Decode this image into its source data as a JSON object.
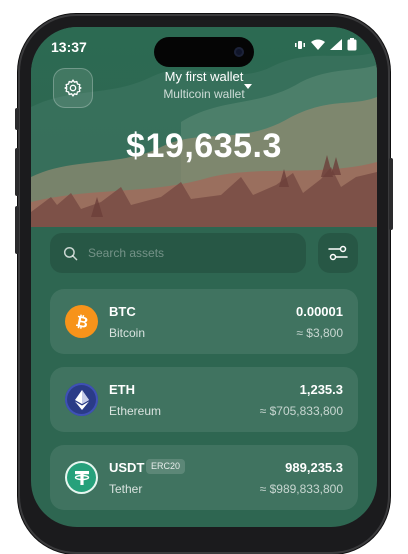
{
  "status_bar": {
    "time": "13:37"
  },
  "header": {
    "wallet_name": "My first wallet",
    "wallet_type": "Multicoin wallet",
    "balance": "$19,635.3"
  },
  "search": {
    "placeholder": "Search assets"
  },
  "colors": {
    "screen_bg": "#2e6651",
    "btc": "#f7931a",
    "eth": "#5a6ac6",
    "usdt": "#26a17b"
  },
  "assets": [
    {
      "symbol": "BTC",
      "name": "Bitcoin",
      "amount": "0.00001",
      "fiat": "≈ $3,800",
      "icon": "bitcoin-icon"
    },
    {
      "symbol": "ETH",
      "name": "Ethereum",
      "amount": "1,235.3",
      "fiat": "≈ $705,833,800",
      "icon": "ethereum-icon"
    },
    {
      "symbol": "USDT",
      "name": "Tether",
      "badge": "ERC20",
      "amount": "989,235.3",
      "fiat": "≈ $989,833,800",
      "icon": "tether-icon"
    }
  ]
}
